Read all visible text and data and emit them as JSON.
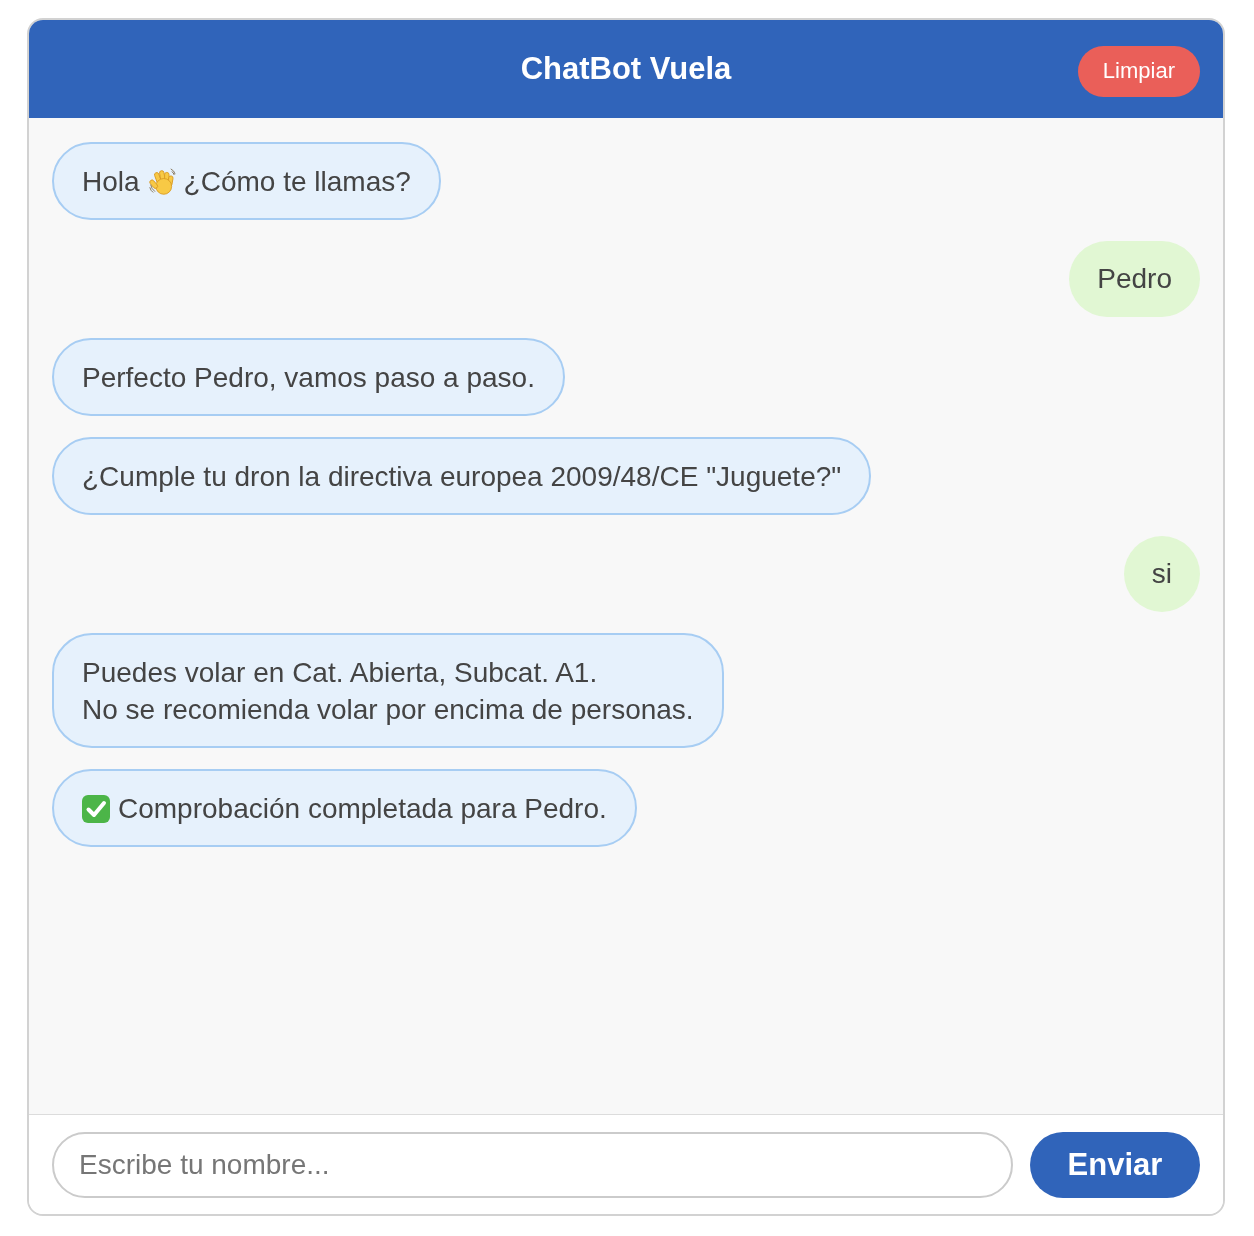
{
  "header": {
    "title": "ChatBot Vuela",
    "clear_button": "Limpiar"
  },
  "messages": [
    {
      "kind": "bot",
      "parts": [
        {
          "kind": "text",
          "text": "Hola"
        },
        {
          "kind": "wave"
        },
        {
          "kind": "text",
          "text": "¿Cómo te llamas?"
        }
      ]
    },
    {
      "kind": "user",
      "parts": [
        {
          "kind": "text",
          "text": "Pedro"
        }
      ]
    },
    {
      "kind": "bot",
      "parts": [
        {
          "kind": "text",
          "text": "Perfecto Pedro, vamos paso a paso."
        }
      ]
    },
    {
      "kind": "bot",
      "parts": [
        {
          "kind": "text",
          "text": "¿Cumple tu dron la directiva europea 2009/48/CE \"Juguete?\""
        }
      ]
    },
    {
      "kind": "user",
      "parts": [
        {
          "kind": "text",
          "text": "si"
        }
      ]
    },
    {
      "kind": "bot",
      "parts": [
        {
          "kind": "text",
          "text": "Puedes volar en Cat. Abierta, Subcat. A1.\nNo se recomienda volar por encima de personas."
        }
      ]
    },
    {
      "kind": "bot",
      "parts": [
        {
          "kind": "check"
        },
        {
          "kind": "text",
          "text": "Comprobación completada para Pedro."
        }
      ]
    }
  ],
  "composer": {
    "placeholder": "Escribe tu nombre...",
    "send_button": "Enviar"
  }
}
